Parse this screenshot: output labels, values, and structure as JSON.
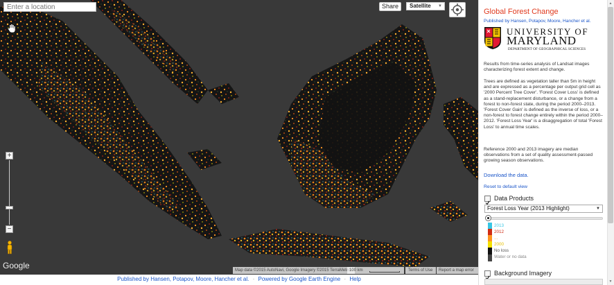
{
  "map": {
    "search_placeholder": "Enter a location",
    "share_label": "Share",
    "map_type": "Satellite",
    "google_logo": "Google",
    "attribution": "Map data ©2015 AutoNavi, Google Imagery ©2015 TerraMetrics",
    "scale_label": "100 km",
    "terms_label": "Terms of Use",
    "report_label": "Report a map error",
    "icons": {
      "pan": "hand-pan-icon",
      "locate": "crosshair-locate-icon",
      "street_view": "pegman-icon"
    }
  },
  "footer": {
    "published_link": "Published by Hansen, Potapov, Moore, Hancher et al.",
    "sep": "·",
    "powered_link": "Powered by Google Earth Engine",
    "help_link": "Help"
  },
  "panel": {
    "title": "Global Forest Change",
    "authors": "Published by Hansen, Potapov, Moore, Hancher et al.",
    "logo": {
      "university": "UNIVERSITY OF",
      "state": "MARYLAND",
      "department": "DEPARTMENT OF GEOGRAPHICAL SCIENCES"
    },
    "intro": "Results from time-series analysis of Landsat images characterizing forest extent and change.",
    "definitions": "Trees are defined as vegetation taller than 5m in height and are expressed as a percentage per output grid cell as '2000 Percent Tree Cover'. 'Forest Cover Loss' is defined as a stand-replacement disturbance, or a change from a forest to non-forest state, during the period 2000–2013. 'Forest Cover Gain' is defined as the inverse of loss, or a non-forest to forest change entirely within the period 2000–2012. 'Forest Loss Year' is a disaggregation of total 'Forest Loss' to annual time scales.",
    "reference": "Reference 2000 and 2013 imagery are median observations from a set of quality assessment-passed growing season observations.",
    "download_link": "Download the data.",
    "reset_link": "Reset to default view",
    "data_products_label": "Data Products",
    "data_products_checked": true,
    "layer_selected": "Forest Loss Year (2013 Highlight)",
    "legend": {
      "y2013": "2013",
      "y2012": "2012",
      "dots": "...",
      "y2000": "2000",
      "no_loss": "No loss",
      "water": "Water or no data"
    },
    "background_label": "Background Imagery",
    "background_checked": true
  },
  "colors": {
    "title": "#e03a1e",
    "link": "#1a55c9",
    "map_bg": "#393939",
    "land": "#131313",
    "loss_2013": "#38c6e4",
    "loss_2012": "#d02c14",
    "loss_mid": "#ff9420",
    "loss_2000": "#f4e000"
  }
}
